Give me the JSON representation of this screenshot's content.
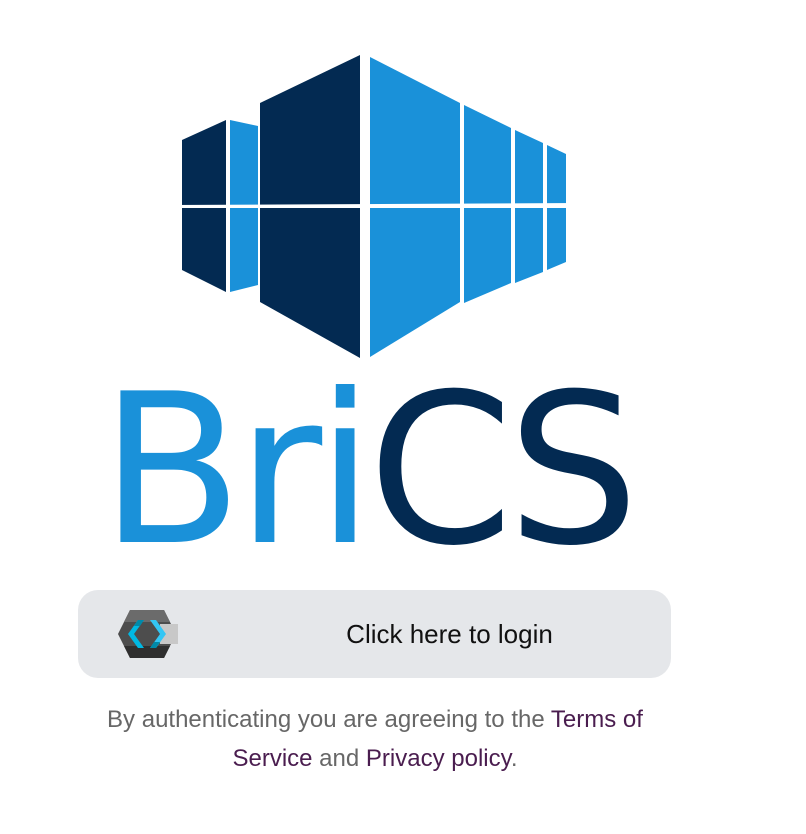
{
  "brand": {
    "wordmark_light": "Bri",
    "wordmark_dark": "CS",
    "colors": {
      "light_blue": "#1a91d9",
      "dark_navy": "#032a52"
    }
  },
  "login": {
    "icon": "keycloak-icon",
    "label": "Click here to login"
  },
  "notice": {
    "prefix": "By authenticating you are agreeing to the ",
    "terms_link": "Terms of Service",
    "middle": " and ",
    "privacy_link": "Privacy policy",
    "suffix": "."
  }
}
